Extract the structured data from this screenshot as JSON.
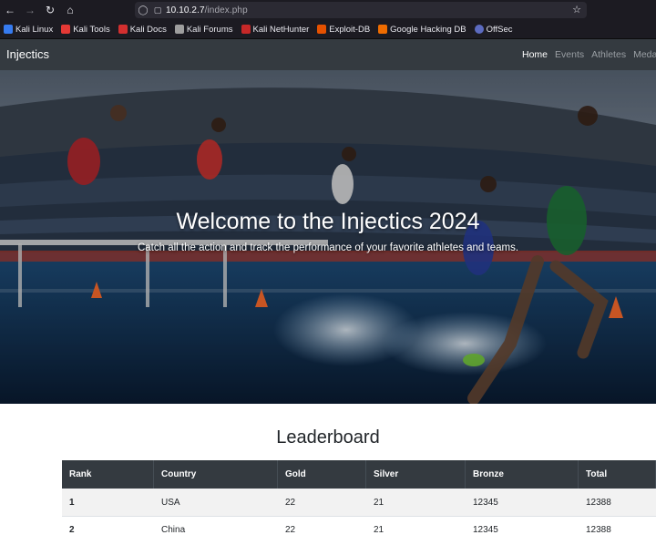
{
  "browser": {
    "url_host": "10.10.2.7",
    "url_path": "/index.php",
    "bookmarks": [
      {
        "label": "Kali Linux",
        "color": "#367bf0"
      },
      {
        "label": "Kali Tools",
        "color": "#e53935"
      },
      {
        "label": "Kali Docs",
        "color": "#d32f2f"
      },
      {
        "label": "Kali Forums",
        "color": "#9e9e9e"
      },
      {
        "label": "Kali NetHunter",
        "color": "#c62828"
      },
      {
        "label": "Exploit-DB",
        "color": "#e65100"
      },
      {
        "label": "Google Hacking DB",
        "color": "#ef6c00"
      },
      {
        "label": "OffSec",
        "color": "#5c6bc0"
      }
    ]
  },
  "navbar": {
    "brand": "Injectics",
    "links": [
      {
        "label": "Home",
        "active": true
      },
      {
        "label": "Events",
        "active": false
      },
      {
        "label": "Athletes",
        "active": false
      },
      {
        "label": "Meda",
        "active": false
      }
    ]
  },
  "hero": {
    "title": "Welcome to the Injectics 2024",
    "subtitle": "Catch all the action and track the performance of your favorite athletes and teams."
  },
  "leaderboard": {
    "title": "Leaderboard",
    "columns": [
      "Rank",
      "Country",
      "Gold",
      "Silver",
      "Bronze",
      "Total"
    ],
    "rows": [
      [
        "1",
        "USA",
        "22",
        "21",
        "12345",
        "12388"
      ],
      [
        "2",
        "China",
        "22",
        "21",
        "12345",
        "12388"
      ]
    ]
  }
}
